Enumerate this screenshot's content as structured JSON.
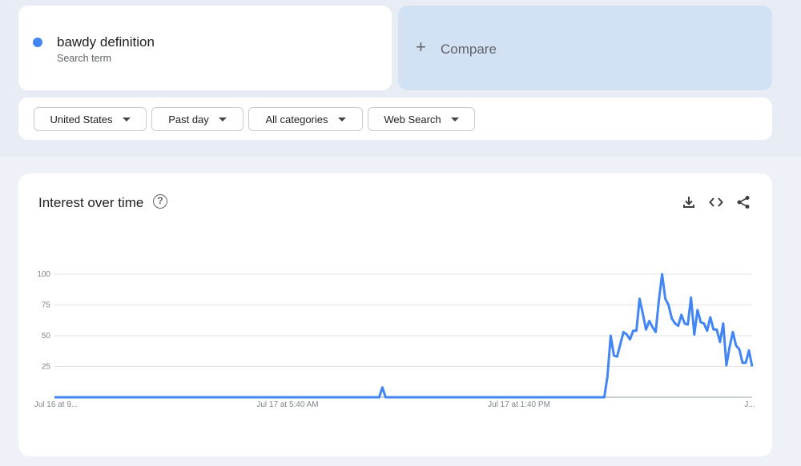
{
  "search": {
    "term": "bawdy definition",
    "term_sub": "Search term",
    "term_color": "#4285f4",
    "compare_label": "Compare",
    "compare_icon": "plus-icon"
  },
  "filters": [
    {
      "label": "United States"
    },
    {
      "label": "Past day"
    },
    {
      "label": "All categories"
    },
    {
      "label": "Web Search"
    }
  ],
  "panel": {
    "title": "Interest over time",
    "help_icon": "help-circle-icon",
    "tools": [
      "download-icon",
      "embed-code-icon",
      "share-icon"
    ]
  },
  "chart_data": {
    "type": "line",
    "title": "",
    "ylim": [
      0,
      100
    ],
    "y_ticks": [
      25,
      50,
      75,
      100
    ],
    "x_tick_labels": [
      "Jul 16 at 9...",
      "Jul 17 at 5:40 AM",
      "Jul 17 at 1:40 PM",
      "J..."
    ],
    "grid": true,
    "series": [
      {
        "color": "#4285f4",
        "values": [
          0,
          0,
          0,
          0,
          0,
          0,
          0,
          0,
          0,
          0,
          0,
          0,
          0,
          0,
          0,
          0,
          0,
          0,
          0,
          0,
          0,
          0,
          0,
          0,
          0,
          0,
          0,
          0,
          0,
          0,
          0,
          0,
          0,
          0,
          0,
          0,
          0,
          0,
          0,
          0,
          0,
          0,
          0,
          0,
          0,
          0,
          0,
          0,
          0,
          0,
          0,
          0,
          0,
          0,
          0,
          0,
          0,
          0,
          0,
          0,
          0,
          0,
          0,
          0,
          0,
          0,
          0,
          0,
          0,
          0,
          0,
          0,
          0,
          0,
          0,
          0,
          0,
          0,
          0,
          0,
          0,
          0,
          0,
          0,
          0,
          0,
          0,
          0,
          0,
          0,
          0,
          0,
          0,
          0,
          0,
          0,
          0,
          0,
          0,
          0,
          0,
          0,
          8,
          0,
          0,
          0,
          0,
          0,
          0,
          0,
          0,
          0,
          0,
          0,
          0,
          0,
          0,
          0,
          0,
          0,
          0,
          0,
          0,
          0,
          0,
          0,
          0,
          0,
          0,
          0,
          0,
          0,
          0,
          0,
          0,
          0,
          0,
          0,
          0,
          0,
          0,
          0,
          0,
          0,
          0,
          0,
          0,
          0,
          0,
          0,
          0,
          0,
          0,
          0,
          0,
          0,
          0,
          0,
          0,
          0,
          0,
          0,
          0,
          0,
          0,
          0,
          0,
          0,
          0,
          0,
          0,
          0,
          17,
          50,
          34,
          33,
          43,
          53,
          51,
          47,
          54,
          54,
          80,
          68,
          55,
          62,
          57,
          53,
          79,
          100,
          80,
          75,
          64,
          60,
          58,
          67,
          60,
          59,
          81,
          51,
          71,
          61,
          60,
          54,
          65,
          55,
          55,
          45,
          60,
          26,
          41,
          53,
          42,
          39,
          28,
          28,
          38,
          25
        ]
      }
    ]
  }
}
